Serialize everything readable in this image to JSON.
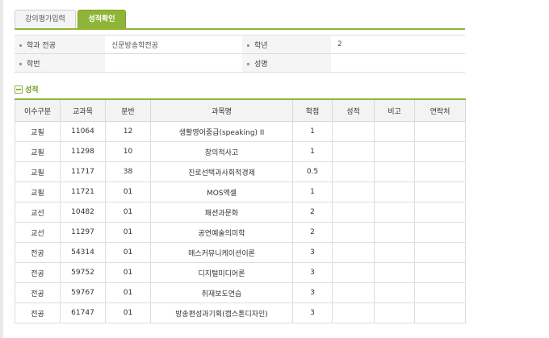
{
  "tabs": [
    {
      "label": "강의평가입력"
    },
    {
      "label": "성적확인"
    }
  ],
  "student": {
    "major_label": "학과 전공",
    "major_value": "신문방송학전공",
    "year_label": "학년",
    "year_value": "2",
    "id_label": "학번",
    "id_value": "",
    "name_label": "성명",
    "name_value": ""
  },
  "section": {
    "title": "성적"
  },
  "grades": {
    "headers": [
      "이수구분",
      "교과목",
      "분반",
      "과목명",
      "학점",
      "성적",
      "비고",
      "연락처"
    ],
    "rows": [
      {
        "type": "교필",
        "code": "11064",
        "section": "12",
        "name": "생활영어중급(speaking) II",
        "credit": "1",
        "grade": "",
        "note": "",
        "contact": ""
      },
      {
        "type": "교필",
        "code": "11298",
        "section": "10",
        "name": "창의적사고",
        "credit": "1",
        "grade": "",
        "note": "",
        "contact": ""
      },
      {
        "type": "교필",
        "code": "11717",
        "section": "38",
        "name": "진로선택과사회적경제",
        "credit": "0.5",
        "grade": "",
        "note": "",
        "contact": ""
      },
      {
        "type": "교필",
        "code": "11721",
        "section": "01",
        "name": "MOS엑셀",
        "credit": "1",
        "grade": "",
        "note": "",
        "contact": ""
      },
      {
        "type": "교선",
        "code": "10482",
        "section": "01",
        "name": "패션과문화",
        "credit": "2",
        "grade": "",
        "note": "",
        "contact": ""
      },
      {
        "type": "교선",
        "code": "11297",
        "section": "01",
        "name": "공연예술의미학",
        "credit": "2",
        "grade": "",
        "note": "",
        "contact": ""
      },
      {
        "type": "전공",
        "code": "54314",
        "section": "01",
        "name": "매스커뮤니케이션이론",
        "credit": "3",
        "grade": "",
        "note": "",
        "contact": ""
      },
      {
        "type": "전공",
        "code": "59752",
        "section": "01",
        "name": "디지털미디어론",
        "credit": "3",
        "grade": "",
        "note": "",
        "contact": ""
      },
      {
        "type": "전공",
        "code": "59767",
        "section": "01",
        "name": "취재보도연습",
        "credit": "3",
        "grade": "",
        "note": "",
        "contact": ""
      },
      {
        "type": "전공",
        "code": "61747",
        "section": "01",
        "name": "방송편성과기획(캡스톤디자인)",
        "credit": "3",
        "grade": "",
        "note": "",
        "contact": ""
      }
    ]
  },
  "colors": {
    "accent": "#8fb537",
    "section_title": "#6e9a1e",
    "header_bg": "#f3f3f3"
  }
}
